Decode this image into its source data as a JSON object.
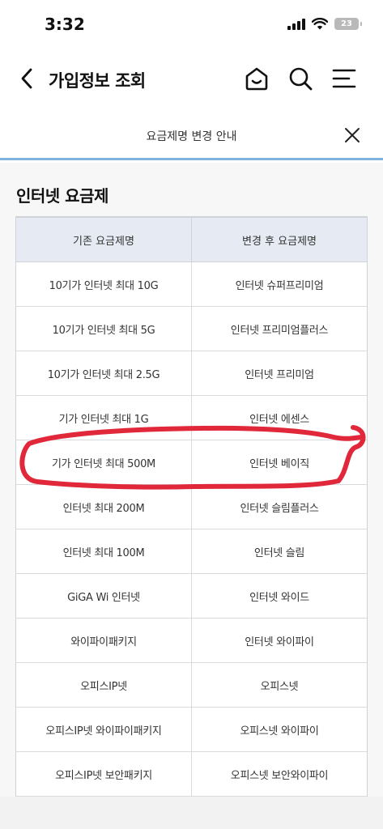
{
  "status": {
    "time": "3:32",
    "battery": "23"
  },
  "header": {
    "title": "가입정보 조회"
  },
  "notice": {
    "text": "요금제명 변경 안내"
  },
  "section": {
    "title": "인터넷 요금제"
  },
  "table": {
    "headers": [
      "기존 요금제명",
      "변경 후 요금제명"
    ],
    "rows": [
      [
        "10기가 인터넷 최대 10G",
        "인터넷 슈퍼프리미엄"
      ],
      [
        "10기가 인터넷 최대 5G",
        "인터넷 프리미엄플러스"
      ],
      [
        "10기가 인터넷 최대 2.5G",
        "인터넷 프리미엄"
      ],
      [
        "기가 인터넷 최대 1G",
        "인터넷 에센스"
      ],
      [
        "기가 인터넷 최대 500M",
        "인터넷 베이직"
      ],
      [
        "인터넷 최대 200M",
        "인터넷 슬림플러스"
      ],
      [
        "인터넷 최대 100M",
        "인터넷 슬림"
      ],
      [
        "GiGA Wi 인터넷",
        "인터넷 와이드"
      ],
      [
        "와이파이패키지",
        "인터넷 와이파이"
      ],
      [
        "오피스IP넷",
        "오피스넷"
      ],
      [
        "오피스IP넷 와이파이패키지",
        "오피스넷 와이파이"
      ],
      [
        "오피스IP넷 보안패키지",
        "오피스넷 보안와이파이"
      ]
    ]
  },
  "colors": {
    "accent_line": "#7fb3de",
    "table_header_bg": "#e6ebf3",
    "annotation_red": "#e0283a"
  }
}
